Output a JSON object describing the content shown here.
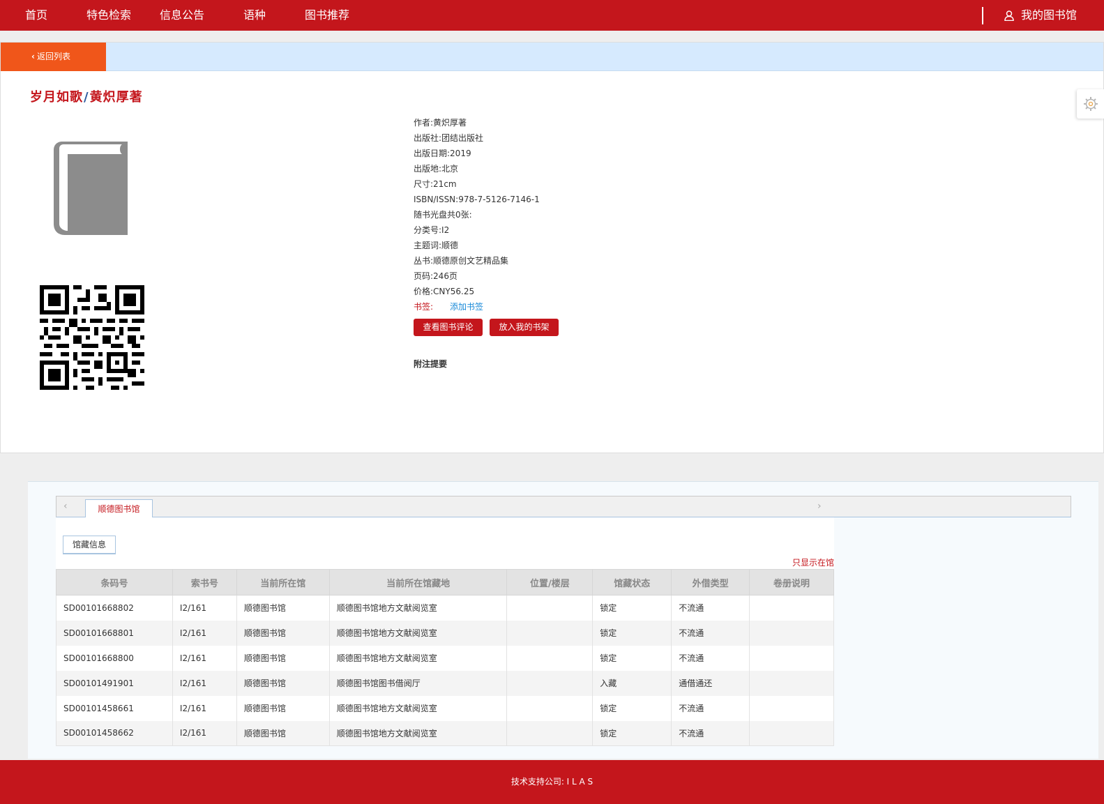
{
  "nav": {
    "items": [
      "首页",
      "特色检索",
      "信息公告",
      "语种",
      "图书推荐"
    ],
    "my_library": "我的图书馆"
  },
  "back_label": "返回列表",
  "book": {
    "title": "岁月如歌",
    "slash": "/",
    "author_line": "黄炽厚著"
  },
  "details": [
    {
      "k": "作者:",
      "v": "黄炽厚著"
    },
    {
      "k": "出版社:",
      "v": "团结出版社"
    },
    {
      "k": "出版日期:",
      "v": "2019"
    },
    {
      "k": "出版地:",
      "v": "北京"
    },
    {
      "k": "尺寸:",
      "v": "21cm"
    },
    {
      "k": "ISBN/ISSN:",
      "v": "978-7-5126-7146-1"
    },
    {
      "k": "随书光盘共0张:",
      "v": ""
    },
    {
      "k": "分类号:",
      "v": "I2"
    },
    {
      "k": "主题词:",
      "v": "顺德"
    },
    {
      "k": "丛书:",
      "v": "顺德原创文艺精品集"
    },
    {
      "k": "页码:",
      "v": "246页"
    },
    {
      "k": "价格:",
      "v": "CNY56.25"
    }
  ],
  "bookmark": {
    "label": "书签:",
    "action": "添加书签"
  },
  "buttons": {
    "view_reviews": "查看图书评论",
    "add_shelf": "放入我的书架"
  },
  "remark_heading": "附注提要",
  "holdings": {
    "library_tab": "顺德图书馆",
    "sub_tab": "馆藏信息",
    "only_in_library": "只显示在馆",
    "headers": [
      "条码号",
      "索书号",
      "当前所在馆",
      "当前所在馆藏地",
      "位置/楼层",
      "馆藏状态",
      "外借类型",
      "卷册说明"
    ],
    "rows": [
      [
        "SD00101668802",
        "I2/161",
        "顺德图书馆",
        "顺德图书馆地方文献阅览室",
        "",
        "锁定",
        "不流通",
        ""
      ],
      [
        "SD00101668801",
        "I2/161",
        "顺德图书馆",
        "顺德图书馆地方文献阅览室",
        "",
        "锁定",
        "不流通",
        ""
      ],
      [
        "SD00101668800",
        "I2/161",
        "顺德图书馆",
        "顺德图书馆地方文献阅览室",
        "",
        "锁定",
        "不流通",
        ""
      ],
      [
        "SD00101491901",
        "I2/161",
        "顺德图书馆",
        "顺德图书馆图书借阅厅",
        "",
        "入藏",
        "通借通还",
        ""
      ],
      [
        "SD00101458661",
        "I2/161",
        "顺德图书馆",
        "顺德图书馆地方文献阅览室",
        "",
        "锁定",
        "不流通",
        ""
      ],
      [
        "SD00101458662",
        "I2/161",
        "顺德图书馆",
        "顺德图书馆地方文献阅览室",
        "",
        "锁定",
        "不流通",
        ""
      ]
    ]
  },
  "footer": "技术支持公司: I L A S",
  "colors": {
    "brand_red": "#c4161c",
    "back_orange": "#f0561a",
    "bar_blue": "#d6eafe",
    "link_blue": "#1a8ad8"
  },
  "icons": [
    "user-icon",
    "chevron-left-icon",
    "book-icon",
    "qr-code",
    "gear-icon",
    "chevron-left-icon",
    "chevron-right-icon"
  ]
}
